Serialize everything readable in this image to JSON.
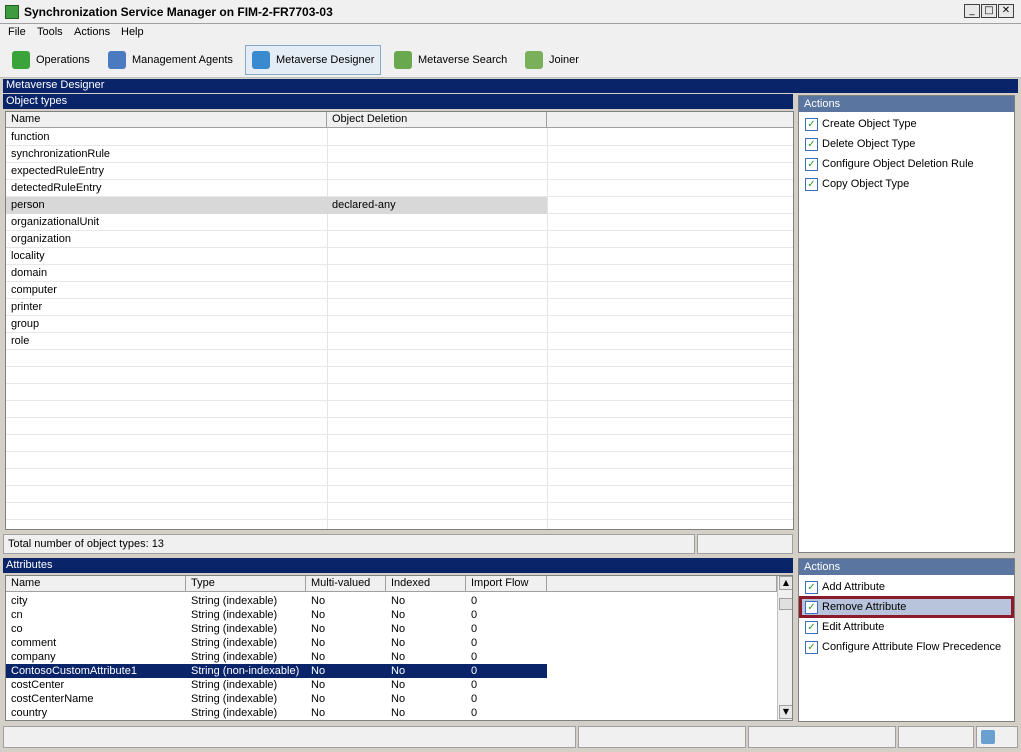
{
  "window": {
    "title": "Synchronization Service Manager on FIM-2-FR7703-03"
  },
  "menu": [
    "File",
    "Tools",
    "Actions",
    "Help"
  ],
  "toolbar": [
    {
      "label": "Operations",
      "icon": "operations-icon",
      "color": "#3aa33a"
    },
    {
      "label": "Management Agents",
      "icon": "management-agents-icon",
      "color": "#4a7ac0"
    },
    {
      "label": "Metaverse Designer",
      "icon": "metaverse-designer-icon",
      "color": "#3a8ad0"
    },
    {
      "label": "Metaverse Search",
      "icon": "metaverse-search-icon",
      "color": "#6aa84f"
    },
    {
      "label": "Joiner",
      "icon": "joiner-icon",
      "color": "#7ab05a"
    }
  ],
  "section_title": "Metaverse Designer",
  "object_types": {
    "header": "Object types",
    "columns": [
      "Name",
      "Object Deletion"
    ],
    "rows": [
      {
        "name": "function",
        "deletion": ""
      },
      {
        "name": "synchronizationRule",
        "deletion": ""
      },
      {
        "name": "expectedRuleEntry",
        "deletion": ""
      },
      {
        "name": "detectedRuleEntry",
        "deletion": ""
      },
      {
        "name": "person",
        "deletion": "declared-any",
        "selected": true
      },
      {
        "name": "organizationalUnit",
        "deletion": ""
      },
      {
        "name": "organization",
        "deletion": ""
      },
      {
        "name": "locality",
        "deletion": ""
      },
      {
        "name": "domain",
        "deletion": ""
      },
      {
        "name": "computer",
        "deletion": ""
      },
      {
        "name": "printer",
        "deletion": ""
      },
      {
        "name": "group",
        "deletion": ""
      },
      {
        "name": "role",
        "deletion": ""
      }
    ],
    "total": "Total number of object types: 13"
  },
  "object_actions": {
    "header": "Actions",
    "items": [
      "Create Object Type",
      "Delete Object Type",
      "Configure Object Deletion Rule",
      "Copy Object Type"
    ]
  },
  "attributes": {
    "header": "Attributes",
    "columns": [
      "Name",
      "Type",
      "Multi-valued",
      "Indexed",
      "Import Flow"
    ],
    "rows": [
      {
        "name": "city",
        "type": "String (indexable)",
        "multi": "No",
        "indexed": "No",
        "flow": "0"
      },
      {
        "name": "cn",
        "type": "String (indexable)",
        "multi": "No",
        "indexed": "No",
        "flow": "0"
      },
      {
        "name": "co",
        "type": "String (indexable)",
        "multi": "No",
        "indexed": "No",
        "flow": "0"
      },
      {
        "name": "comment",
        "type": "String (indexable)",
        "multi": "No",
        "indexed": "No",
        "flow": "0"
      },
      {
        "name": "company",
        "type": "String (indexable)",
        "multi": "No",
        "indexed": "No",
        "flow": "0"
      },
      {
        "name": "ContosoCustomAttribute1",
        "type": "String (non-indexable)",
        "multi": "No",
        "indexed": "No",
        "flow": "0",
        "selected": true
      },
      {
        "name": "costCenter",
        "type": "String (indexable)",
        "multi": "No",
        "indexed": "No",
        "flow": "0"
      },
      {
        "name": "costCenterName",
        "type": "String (indexable)",
        "multi": "No",
        "indexed": "No",
        "flow": "0"
      },
      {
        "name": "country",
        "type": "String (indexable)",
        "multi": "No",
        "indexed": "No",
        "flow": "0"
      }
    ]
  },
  "attribute_actions": {
    "header": "Actions",
    "items": [
      "Add Attribute",
      "Remove Attribute",
      "Edit Attribute",
      "Configure Attribute Flow Precedence"
    ],
    "highlighted": "Remove Attribute",
    "highlight_color": "#8b1a2a"
  }
}
